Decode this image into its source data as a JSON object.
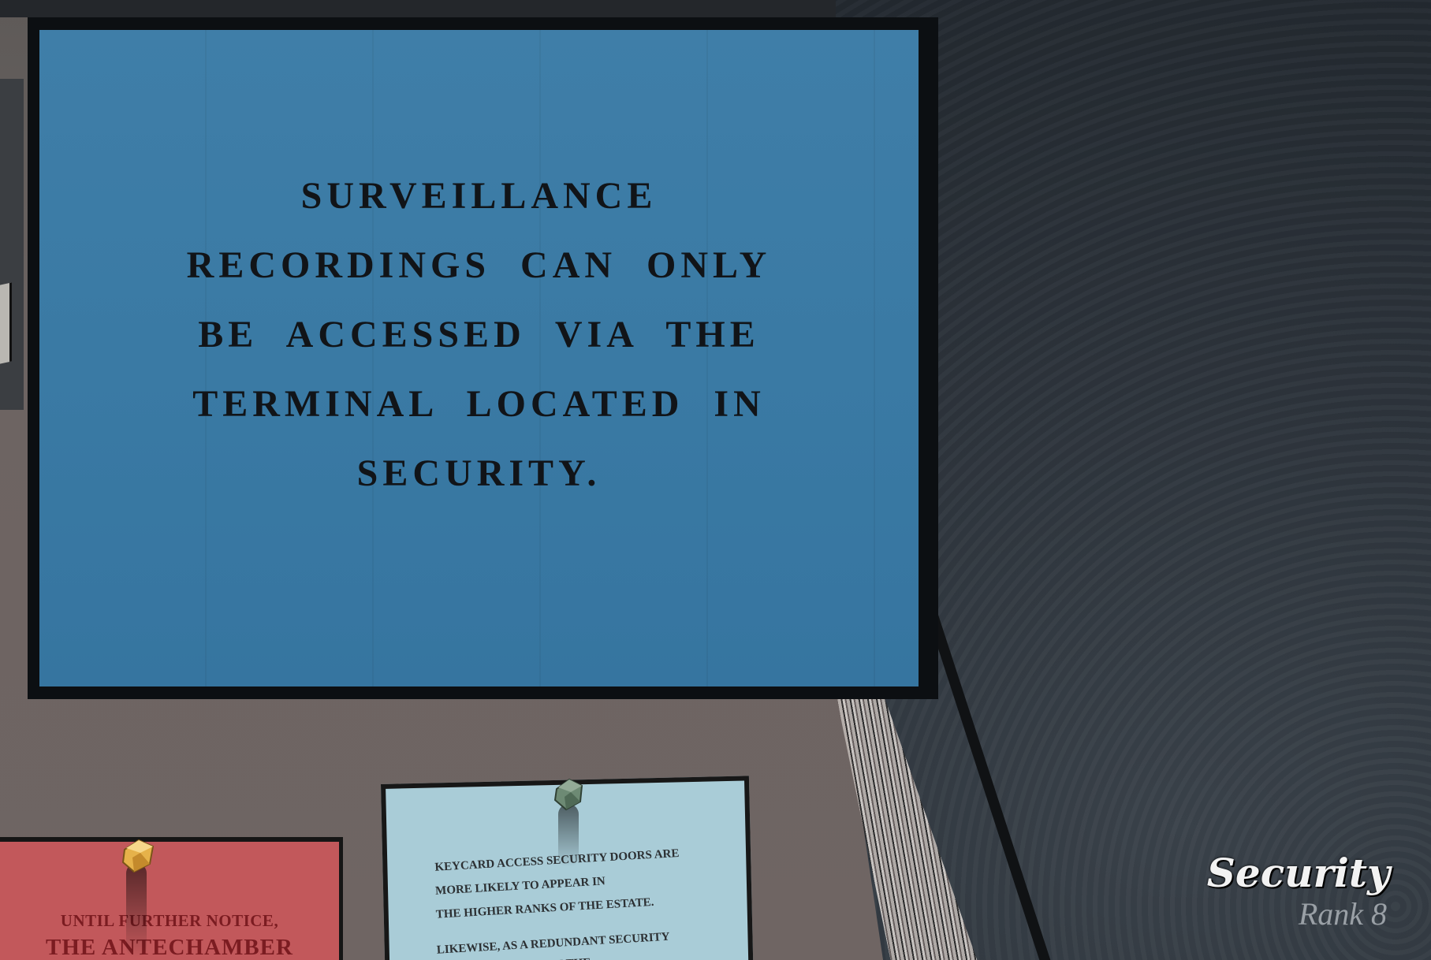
{
  "main_notice": {
    "lines": [
      "SURVEILLANCE",
      "RECORDINGS CAN ONLY",
      "BE ACCESSED VIA THE",
      "TERMINAL LOCATED IN",
      "SECURITY."
    ],
    "background_color": "#3a7aa4",
    "text_color": "#111418"
  },
  "red_note": {
    "line1": "UNTIL FURTHER NOTICE,",
    "line2": "THE ANTECHAMBER",
    "background_color": "#c2585b",
    "text_color": "#7b1c21"
  },
  "blue_note": {
    "lines": [
      "KEYCARD ACCESS SECURITY DOORS ARE",
      "MORE LIKELY TO APPEAR IN",
      "THE HIGHER RANKS OF THE ESTATE.",
      "LIKEWISE, AS A REDUNDANT SECURITY",
      "... NORMAL DOORS IN THE"
    ],
    "background_color": "#a9ccd7"
  },
  "pins": {
    "yellow_icon": "yellow-pushpin-icon",
    "green_icon": "green-pushpin-icon"
  },
  "hud": {
    "room_name": "Security",
    "rank": "Rank 8"
  }
}
